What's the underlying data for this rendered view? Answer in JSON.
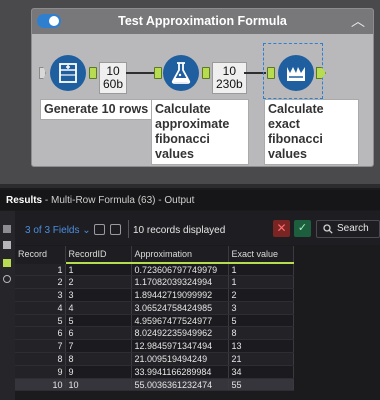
{
  "container": {
    "title": "Test Approximation Formula",
    "collapse_icon": "chevron-up-icon"
  },
  "tools": [
    {
      "label": "Generate 10 rows",
      "icon": "generate-rows-icon"
    },
    {
      "label": "Calculate approximate fibonacci values",
      "icon": "formula-icon"
    },
    {
      "label": "Calculate exact fibonacci values",
      "icon": "multi-row-formula-icon"
    }
  ],
  "connections": [
    {
      "records": "10",
      "size": "60b"
    },
    {
      "records": "10",
      "size": "230b"
    }
  ],
  "results": {
    "title_bold": "Results",
    "title_rest": " - Multi-Row Formula (63) - Output",
    "fields_label": "3 of 3 Fields",
    "fields_caret": "⌄",
    "records_displayed": "10 records displayed",
    "search_label": "Search",
    "columns": [
      "Record",
      "RecordID",
      "Approximation",
      "Exact value"
    ],
    "rows": [
      {
        "record": "1",
        "record_id": "1",
        "approximation": "0.723606797749979",
        "exact": "1"
      },
      {
        "record": "2",
        "record_id": "2",
        "approximation": "1.17082039324994",
        "exact": "1"
      },
      {
        "record": "3",
        "record_id": "3",
        "approximation": "1.89442719099992",
        "exact": "2"
      },
      {
        "record": "4",
        "record_id": "4",
        "approximation": "3.06524758424985",
        "exact": "3"
      },
      {
        "record": "5",
        "record_id": "5",
        "approximation": "4.95967477524977",
        "exact": "5"
      },
      {
        "record": "6",
        "record_id": "6",
        "approximation": "8.02492235949962",
        "exact": "8"
      },
      {
        "record": "7",
        "record_id": "7",
        "approximation": "12.9845971347494",
        "exact": "13"
      },
      {
        "record": "8",
        "record_id": "8",
        "approximation": "21.009519494249",
        "exact": "21"
      },
      {
        "record": "9",
        "record_id": "9",
        "approximation": "33.9941166289984",
        "exact": "34"
      },
      {
        "record": "10",
        "record_id": "10",
        "approximation": "55.0036361232474",
        "exact": "55"
      }
    ]
  },
  "colors": {
    "accent": "#2f7fd1",
    "anchor_green": "#b7dc52",
    "tool_blue": "#1f5fa0"
  }
}
